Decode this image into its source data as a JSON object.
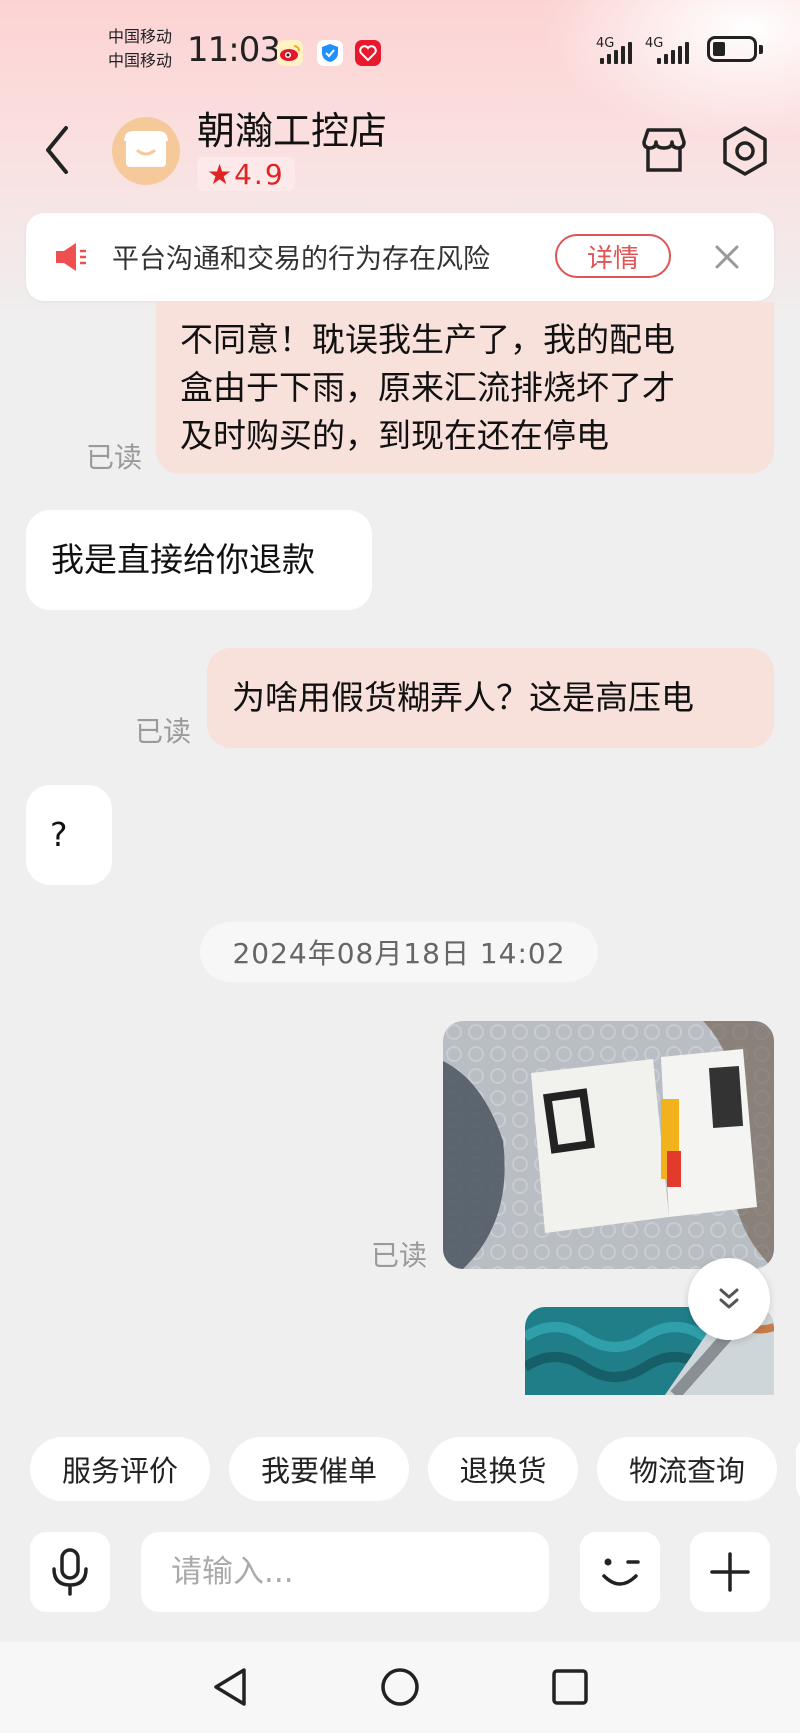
{
  "status_bar": {
    "carrier_1": "中国移动",
    "carrier_2": "中国移动",
    "time": "11:03",
    "network_1": "4G",
    "network_2": "4G",
    "app_icons": [
      "weibo-icon",
      "shield-icon",
      "heart-app-icon"
    ]
  },
  "header": {
    "shop_name": "朝瀚工控店",
    "rating": "4.9",
    "rating_star": "★"
  },
  "notice": {
    "text": "平台沟通和交易的行为存在风险",
    "detail_label": "详情"
  },
  "messages": [
    {
      "from": "me",
      "text": "不同意！耽误我生产了，我的配电盒由于下雨，原来汇流排烧坏了才及时购买的，到现在还在停电",
      "lines": [
        "不同意！耽误我生产了，我的配电",
        "盒由于下雨，原来汇流排烧坏了才",
        "及时购买的，到现在还在停电"
      ],
      "read": "已读"
    },
    {
      "from": "them",
      "text": "我是直接给你退款"
    },
    {
      "from": "me",
      "text": "为啥用假货糊弄人？这是高压电",
      "read": "已读"
    },
    {
      "from": "them",
      "text": "?"
    },
    {
      "timestamp": "2024年08月18日  14:02"
    },
    {
      "from": "me",
      "type": "image",
      "read": "已读"
    },
    {
      "from": "me",
      "type": "image"
    }
  ],
  "quick_replies": [
    "服务评价",
    "我要催单",
    "退换货",
    "物流查询"
  ],
  "input": {
    "placeholder": "请输入..."
  },
  "colors": {
    "accent": "#e02424",
    "my_bubble": "#f8e0db",
    "their_bubble": "#ffffff",
    "background": "#efefef"
  }
}
